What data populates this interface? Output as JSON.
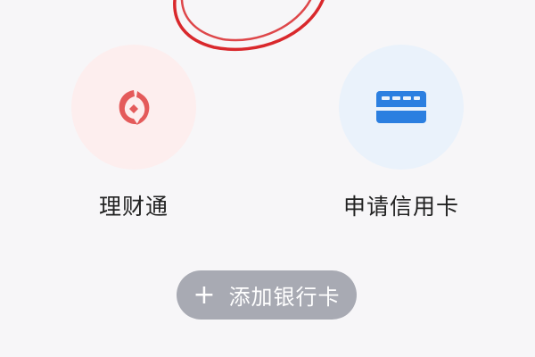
{
  "colors": {
    "background": "#f7f6f8",
    "licaitong_circle": "#fdeeee",
    "licaitong_icon": "#e45b5b",
    "credit_circle": "#eaf2fb",
    "credit_icon": "#2b7fe0",
    "add_button_bg": "#a8aab3",
    "annotation_stroke": "#d9282c"
  },
  "tiles": [
    {
      "label": "理财通",
      "icon": "licaitong-fish-icon"
    },
    {
      "label": "申请信用卡",
      "icon": "credit-card-icon"
    }
  ],
  "add_card": {
    "icon": "plus-icon",
    "plus": "+",
    "label": "添加银行卡"
  }
}
